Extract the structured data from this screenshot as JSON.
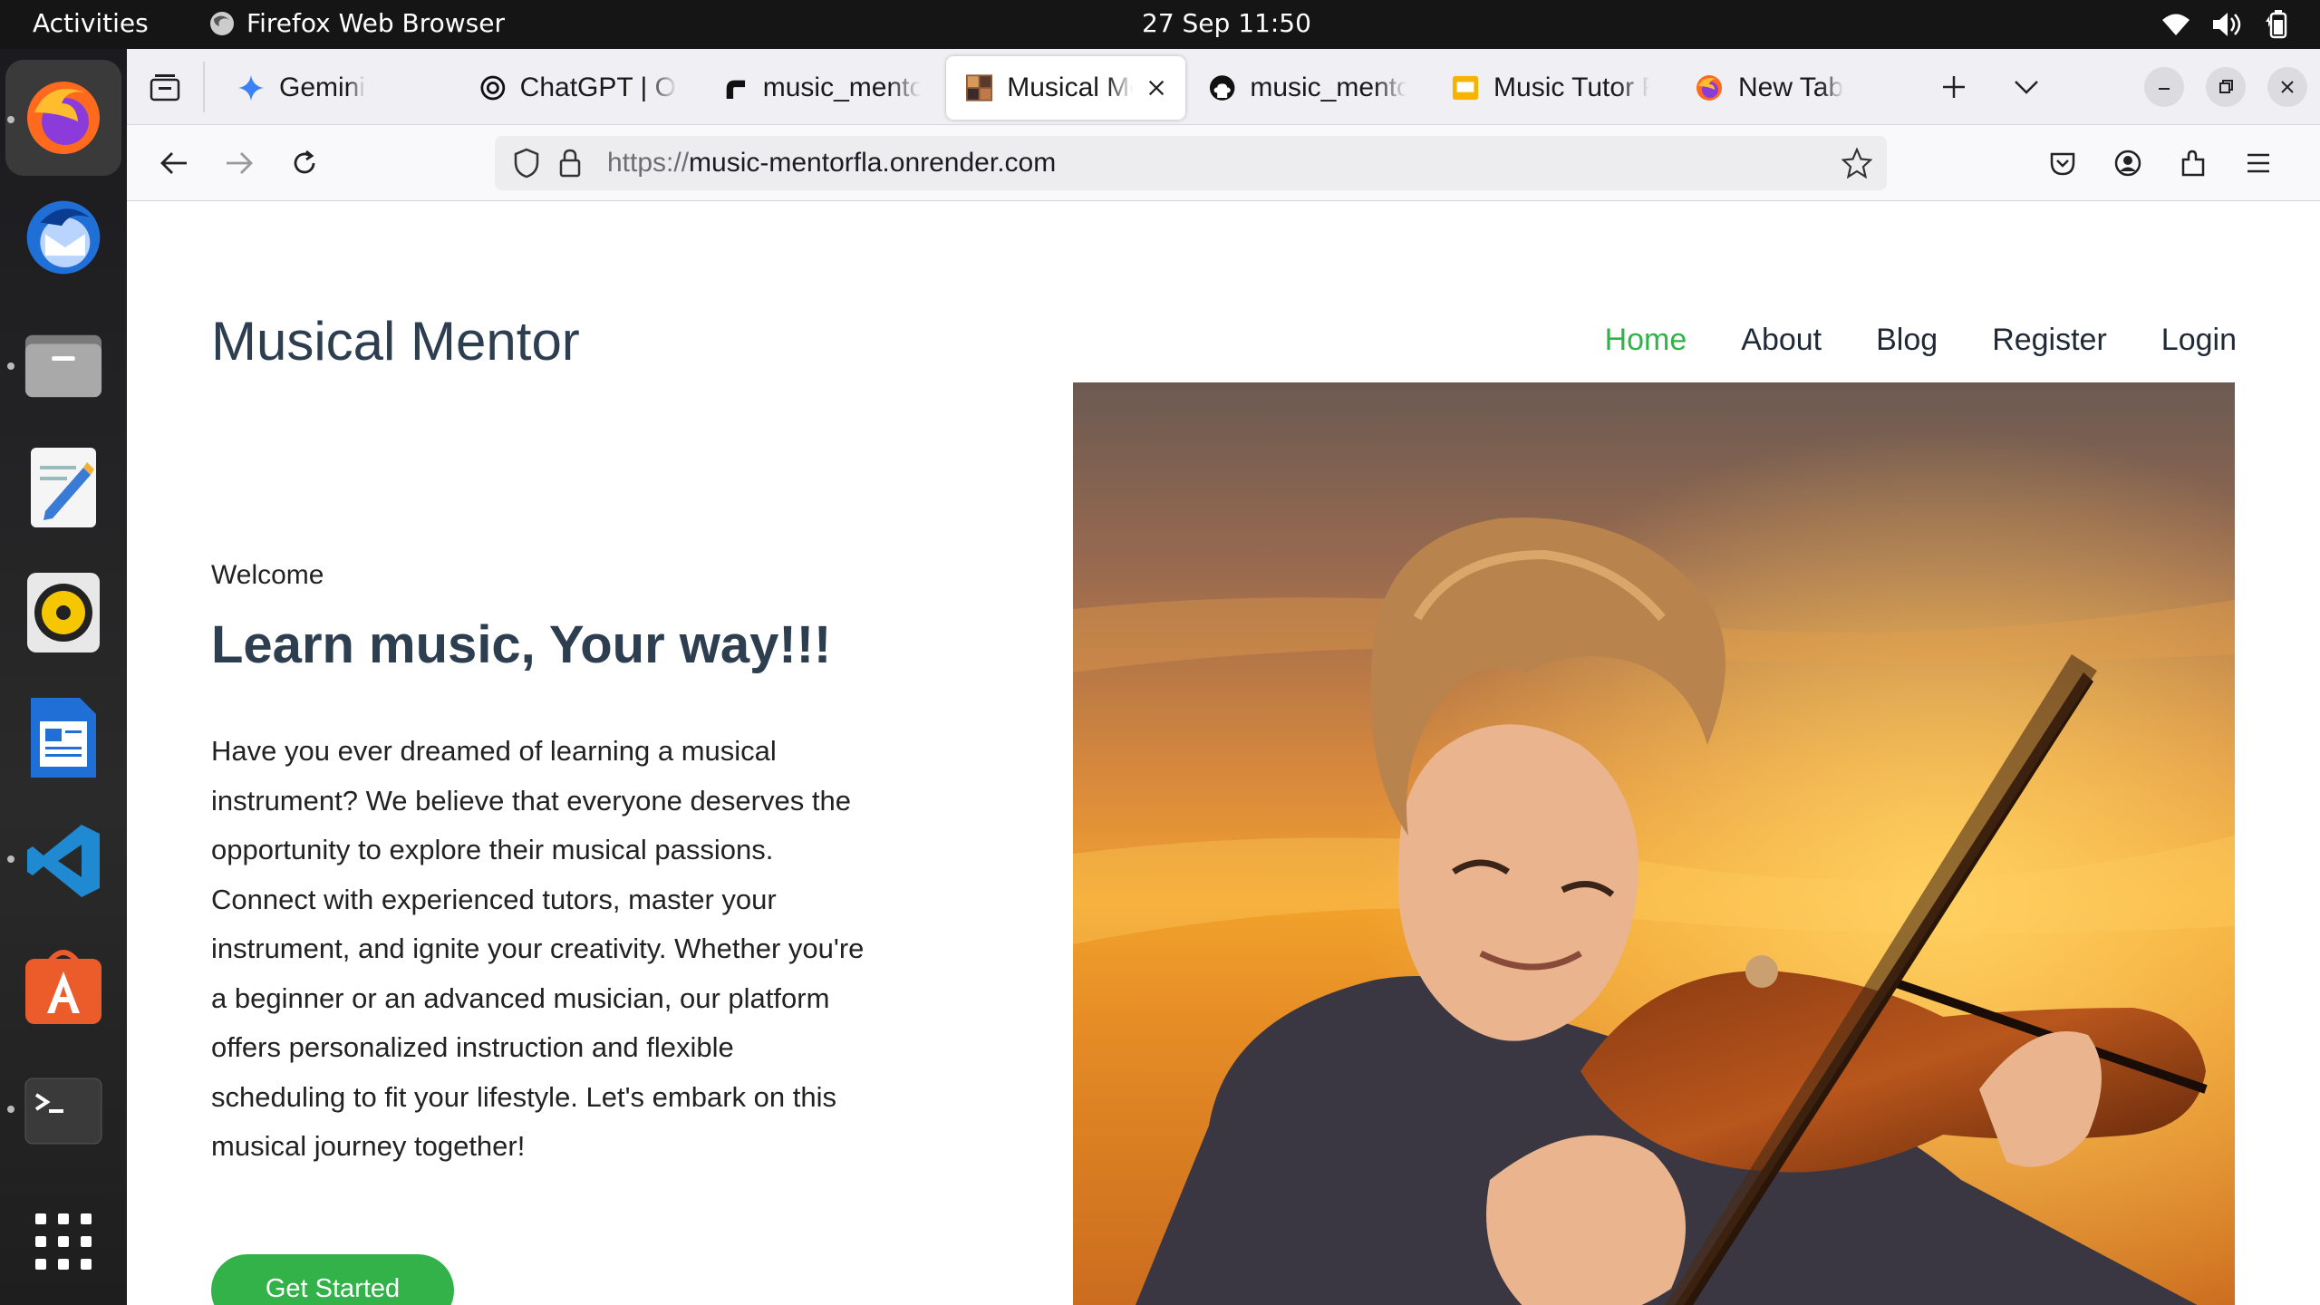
{
  "system": {
    "activities": "Activities",
    "app_name": "Firefox Web Browser",
    "clock": "27 Sep  11:50"
  },
  "browser": {
    "tabs": [
      {
        "label": "Gemini",
        "icon": "gemini-icon"
      },
      {
        "label": "ChatGPT | Op",
        "icon": "openai-icon"
      },
      {
        "label": "music_mentor",
        "icon": "render-icon"
      },
      {
        "label": "Musical Me",
        "icon": "site-favicon",
        "selected": true
      },
      {
        "label": "music_mentor",
        "icon": "github-icon"
      },
      {
        "label": "Music Tutor P",
        "icon": "slides-icon"
      },
      {
        "label": "New Tab",
        "icon": "firefox-icon"
      }
    ],
    "url_scheme": "https://",
    "url_host": "music-mentorfla.onrender.com"
  },
  "site": {
    "brand": "Musical Mentor",
    "nav": [
      "Home",
      "About",
      "Blog",
      "Register",
      "Login"
    ],
    "active_nav": "Home",
    "welcome": "Welcome",
    "headline": "Learn music, Your way!!!",
    "paragraph": "Have you ever dreamed of learning a musical instrument? We believe that everyone deserves the opportunity to explore their musical passions. Connect with experienced tutors, master your instrument, and ignite your creativity. Whether you're a beginner or an advanced musician, our platform offers personalized instruction and flexible scheduling to fit your lifestyle. Let's embark on this musical journey together!",
    "cta_label": "Get Started",
    "hero_image": "boy-playing-violin-at-sunset",
    "accent_color": "#33b249",
    "heading_color": "#2d3e50"
  }
}
